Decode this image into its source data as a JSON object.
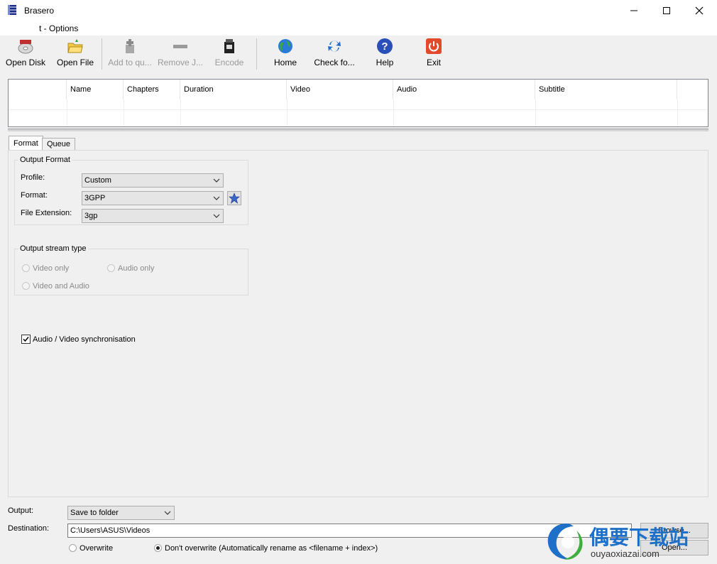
{
  "window": {
    "title": "Brasero",
    "close_glyph": "✕",
    "maximize_glyph": "☐",
    "minimize_glyph": "—"
  },
  "menu": {
    "visible_label": "t - Options"
  },
  "toolbar": {
    "open_disk": "Open Disk",
    "open_file": "Open File",
    "add_queue": "Add to qu...",
    "remove_job": "Remove J...",
    "encode": "Encode",
    "home": "Home",
    "check_for_updates": "Check fo...",
    "help": "Help",
    "exit": "Exit"
  },
  "list": {
    "columns": [
      "",
      "Name",
      "Chapters",
      "Duration",
      "Video",
      "Audio",
      "Subtitle"
    ]
  },
  "tabs": {
    "format": "Format",
    "queue": "Queue"
  },
  "output_format": {
    "title": "Output Format",
    "profile_label": "Profile:",
    "profile_value": "Custom",
    "format_label": "Format:",
    "format_value": "3GPP",
    "extension_label": "File Extension:",
    "extension_value": "3gp"
  },
  "stream_type": {
    "title": "Output stream type",
    "video_only": "Video only",
    "audio_only": "Audio only",
    "video_and_audio": "Video and Audio"
  },
  "sync": {
    "label": "Audio / Video synchronisation",
    "checked": true
  },
  "output": {
    "label": "Output:",
    "value": "Save to folder",
    "destination_label": "Destination:",
    "destination_value": "C:\\Users\\ASUS\\Videos",
    "browse_label": "Browse...",
    "open_label": "Open...",
    "overwrite_label": "Overwrite",
    "dont_overwrite_label": "Don't overwrite (Automatically rename as <filename + index>)"
  },
  "watermark": {
    "cn_text": "偶要下载站",
    "url_text": "ouyaoxiazai.com"
  },
  "colors": {
    "accent": "#1e6fc8",
    "exit_red": "#e24a2b",
    "help_blue": "#2a4fb8"
  }
}
